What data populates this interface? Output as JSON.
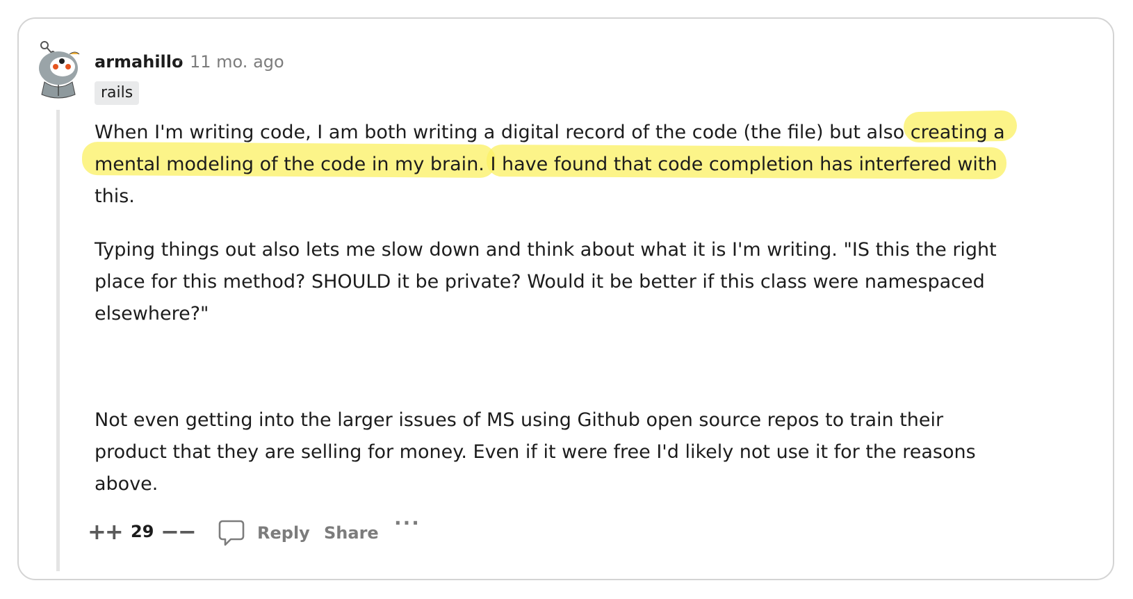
{
  "comment": {
    "username": "armahillo",
    "separator": "·",
    "timestamp": "11 mo. ago",
    "flair": "rails",
    "avatar_icon": "snoo-avatar-icon",
    "paragraphs": [
      {
        "lines": [
          "When I'm writing code, I am both writing a digital record of the code (the file) but also creating a",
          "mental modeling of the code in my brain. I have found that code completion has interfered with",
          "this."
        ]
      },
      {
        "lines": [
          "Typing things out also lets me slow down and think about what it is I'm writing. \"IS this the right",
          "place for this method? SHOULD it be private? Would it be better if this class were namespaced",
          "elsewhere?\""
        ]
      },
      {
        "lines": [
          "Not even getting into the larger issues of MS using Github open source repos to train their",
          "product that they are selling for money. Even if it were free I'd likely not use it for the reasons",
          "above."
        ]
      }
    ],
    "highlight_color": "#fbf168"
  },
  "actions": {
    "upvote_icon": "++",
    "score": "29",
    "downvote_icon": "−−",
    "reply_label": "Reply",
    "share_label": "Share",
    "more_icon": "···"
  }
}
